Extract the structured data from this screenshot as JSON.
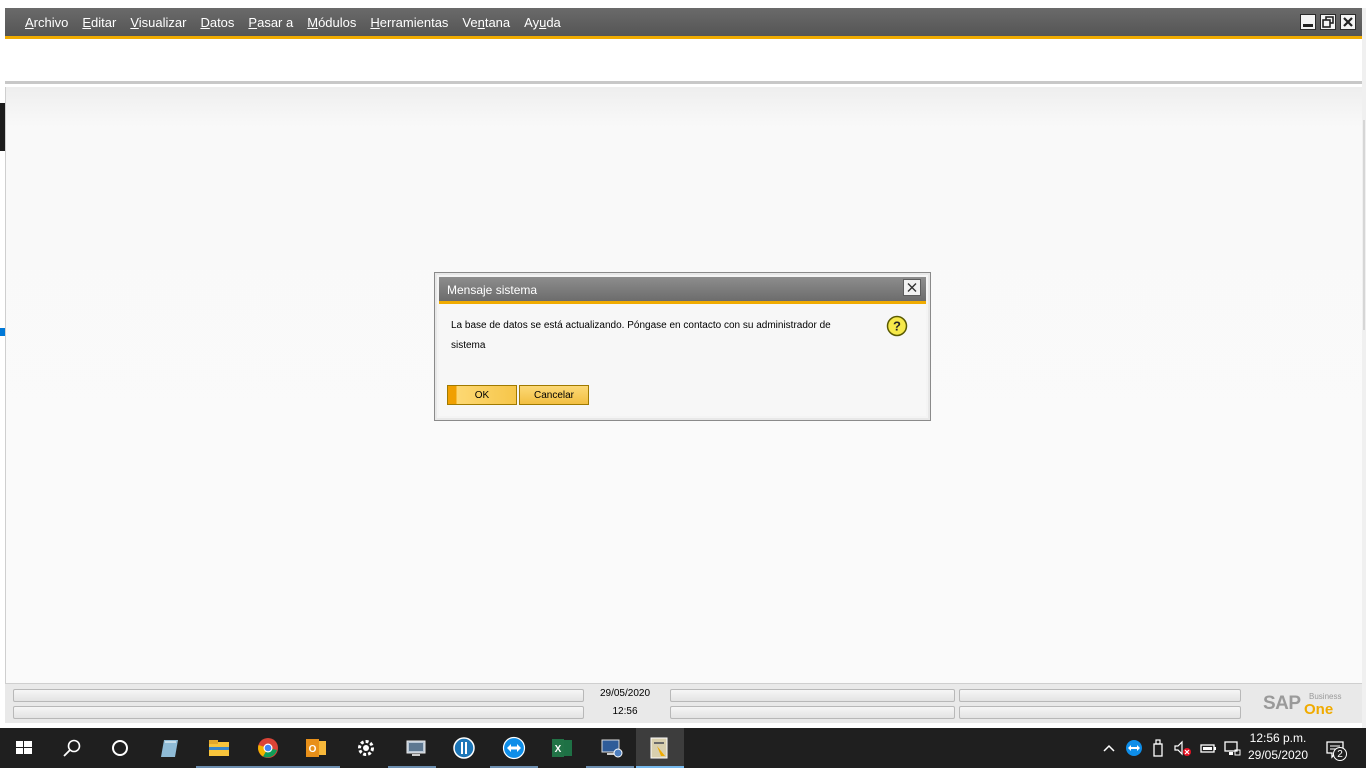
{
  "menubar": {
    "items": [
      {
        "pre": "",
        "u": "A",
        "post": "rchivo"
      },
      {
        "pre": "",
        "u": "E",
        "post": "ditar"
      },
      {
        "pre": "",
        "u": "V",
        "post": "isualizar"
      },
      {
        "pre": "",
        "u": "D",
        "post": "atos"
      },
      {
        "pre": "",
        "u": "P",
        "post": "asar a"
      },
      {
        "pre": "",
        "u": "M",
        "post": "ódulos"
      },
      {
        "pre": "",
        "u": "H",
        "post": "erramientas"
      },
      {
        "pre": "Ve",
        "u": "n",
        "post": "tana"
      },
      {
        "pre": "Ay",
        "u": "u",
        "post": "da"
      }
    ]
  },
  "window_controls": [
    "minimize-icon",
    "restore-icon",
    "close-icon"
  ],
  "dialog": {
    "title": "Mensaje sistema",
    "message": "La base de datos se está actualizando. Póngase en contacto con su administrador de sistema",
    "icon": "question-icon",
    "ok_label": "OK",
    "cancel_label": "Cancelar"
  },
  "statusbar": {
    "date": "29/05/2020",
    "time": "12:56",
    "logo_main": "SAP",
    "logo_sub": "Business",
    "logo_one": "One"
  },
  "taskbar": {
    "apps": [
      "start-icon",
      "search-icon",
      "task-view-icon",
      "notepad-icon",
      "file-explorer-icon",
      "chrome-icon",
      "outlook-icon",
      "settings-icon",
      "network-manager-icon",
      "app-icon",
      "teamviewer-icon",
      "excel-icon",
      "remote-desktop-icon",
      "sap-business-one-icon"
    ],
    "tray": [
      "chevron-up-icon",
      "teamviewer-tray-icon",
      "usb-icon",
      "volume-muted-icon",
      "battery-icon",
      "network-icon"
    ],
    "clock_time": "12:56 p.m.",
    "clock_date": "29/05/2020",
    "notifications": "2"
  },
  "colors": {
    "accent": "#f0ab00",
    "menubar": "#5f5f5f",
    "taskbar": "#1f1f1f"
  }
}
